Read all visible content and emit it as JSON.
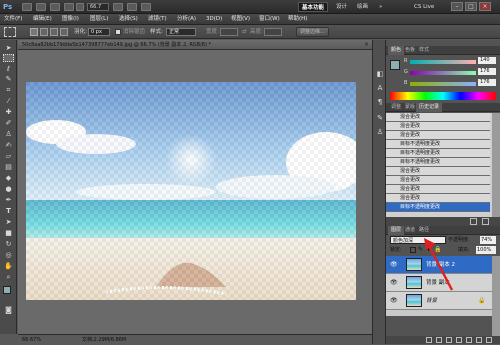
{
  "app": {
    "logo": "Ps",
    "zoom": "66.7",
    "workspaces": [
      "基本功能",
      "设计",
      "绘画"
    ],
    "more": "»",
    "cslive": "CS Live"
  },
  "menu": [
    "文件(F)",
    "编辑(E)",
    "图像(I)",
    "图层(L)",
    "选择(S)",
    "滤镜(T)",
    "分析(A)",
    "3D(D)",
    "视图(V)",
    "窗口(W)",
    "帮助(H)"
  ],
  "options": {
    "feather_label": "羽化:",
    "feather_value": "0 px",
    "antialias_label": "消除锯齿",
    "style_label": "样式:",
    "style_value": "正常",
    "width_label": "宽度:",
    "height_label": "高度:",
    "refine_label": "调整边缘..."
  },
  "document": {
    "tab_title": "50c8aa82bb179dda5b147398777eb149.jpg @ 66.7% (背景 副本 2, RGB/8) *",
    "zoom_status": "66.67%",
    "doc_size": "文档:2.29M/6.86M"
  },
  "color_panel": {
    "tabs": [
      "颜色",
      "色板",
      "样式"
    ],
    "r": "140",
    "g": "176",
    "b": "176",
    "r_label": "R",
    "g_label": "G",
    "b_label": "B"
  },
  "history_panel": {
    "tabs": [
      "调整",
      "蒙版",
      "历史记录"
    ],
    "rows": [
      "混合更改",
      "混合更改",
      "混合更改",
      "目标不透明度更改",
      "目标不透明度更改",
      "目标不透明度更改",
      "混合更改",
      "混合更改",
      "混合更改",
      "混合更改",
      "目标不透明度更改"
    ]
  },
  "layers_panel": {
    "tabs": [
      "图层",
      "通道",
      "路径"
    ],
    "blend_mode": "颜色加深",
    "opacity_label": "不透明度:",
    "opacity_value": "74%",
    "lock_label": "锁定:",
    "fill_label": "填充:",
    "fill_value": "100%",
    "layers": [
      "背景 副本 2",
      "背景 副本",
      "背景"
    ]
  },
  "colors": {
    "accent": "#2f6bc4",
    "arrow": "#e02020"
  }
}
